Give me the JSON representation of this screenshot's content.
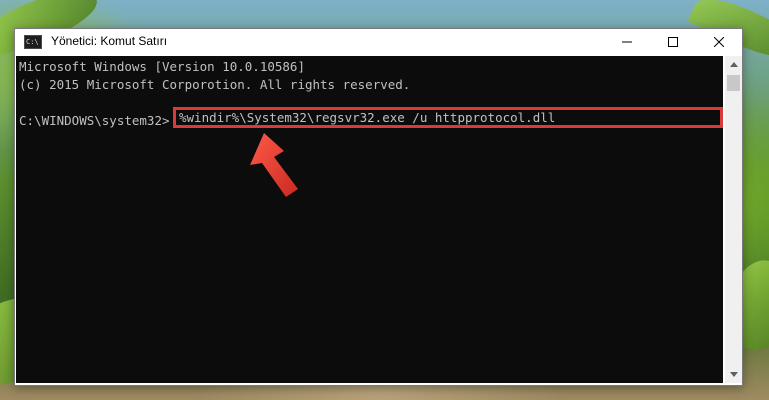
{
  "window": {
    "title": "Yönetici: Komut Satırı",
    "icon_label": "C:\\",
    "icon": "cmd-icon"
  },
  "controls": {
    "minimize_icon": "minimize-icon",
    "maximize_icon": "maximize-icon",
    "close_icon": "close-icon"
  },
  "console": {
    "lines": [
      "Microsoft Windows [Version 10.0.10586]",
      "(c) 2015 Microsoft Corporotion. All rights reserved."
    ],
    "prompt": "C:\\WINDOWS\\system32>",
    "command": "%windir%\\System32\\regsvr32.exe /u httpprotocol.dll"
  },
  "annotation": {
    "highlight_color": "#d93a3a",
    "arrow_icon": "red-arrow-icon"
  },
  "colors": {
    "console_bg": "#0c0c0c",
    "console_text": "#c0c0c0",
    "titlebar_bg": "#ffffff"
  }
}
